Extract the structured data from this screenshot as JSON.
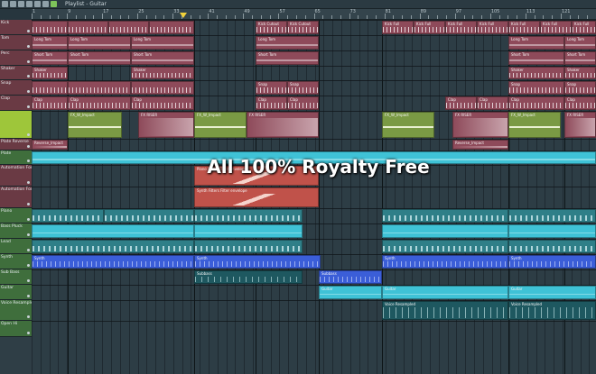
{
  "window": {
    "title": "Playlist - Guitar",
    "toolbar_icons": [
      "pencil-icon",
      "brush-icon",
      "delete-icon",
      "mute-icon",
      "slip-icon",
      "zoom-icon",
      "play-icon"
    ]
  },
  "ruler": {
    "numbers": [
      "1",
      "9",
      "17",
      "25",
      "33",
      "41",
      "49",
      "57",
      "65",
      "73",
      "81",
      "89",
      "97",
      "105",
      "113",
      "121"
    ]
  },
  "overlay": {
    "text": "All 100% Royalty Free"
  },
  "tracks": [
    {
      "label": "Kick",
      "color": "pink"
    },
    {
      "label": "Tom",
      "color": "pink"
    },
    {
      "label": "Perc",
      "color": "pink"
    },
    {
      "label": "Shaker",
      "color": "pink"
    },
    {
      "label": "Snap",
      "color": "pink"
    },
    {
      "label": "Clap",
      "color": "pink"
    },
    {
      "label": "",
      "color": "lime"
    },
    {
      "label": "Plate Reverse",
      "color": "pink"
    },
    {
      "label": "Plate",
      "color": "green"
    },
    {
      "label": "Automation For Piano",
      "color": "pink"
    },
    {
      "label": "Automation For Synth",
      "color": "pink"
    },
    {
      "label": "Piano",
      "color": "green"
    },
    {
      "label": "Bass Pluck",
      "color": "green"
    },
    {
      "label": "Lead",
      "color": "green"
    },
    {
      "label": "Synth",
      "color": "green"
    },
    {
      "label": "Sub Bass",
      "color": "green"
    },
    {
      "label": "Guitar",
      "color": "green"
    },
    {
      "label": "Voice Resampled",
      "color": "green"
    },
    {
      "label": "Open Hi",
      "color": "green"
    }
  ],
  "clip_labels": {
    "kick": "Kick Full",
    "kick_cutout": "Kick Cutout",
    "tom": "Long Tom",
    "perc": "Short Tom",
    "shaker": "Shaker",
    "snap": "Snap",
    "clap": "Clap",
    "impact": "FX_W_Impact",
    "riser": "FX RISER",
    "reverse": "Reverse_Impact",
    "piano_auto": "Piano Filters Filter envelope",
    "synth_auto": "Synth Filters Filter envelope",
    "synth": "Synth",
    "subbass": "Subbass",
    "guitar": "Guitar",
    "voice": "Voice Resampled"
  }
}
